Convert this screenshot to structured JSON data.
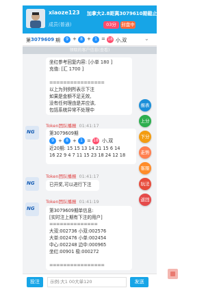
{
  "header": {
    "username": "xiaoze123",
    "user_tag": "成员(普通)",
    "issue_title": "加拿大2.8距离3079610期截止",
    "countdown": "03分",
    "status": "封盘中"
  },
  "result_bar": {
    "prefix": "第",
    "issue": "3079609",
    "qi": "期",
    "balls": [
      "9",
      "8",
      "1",
      "18"
    ],
    "ball_colors": [
      "#1e90ff",
      "#1e90ff",
      "#1e90ff",
      "#ff4d6d"
    ],
    "ops": [
      "+",
      "+",
      "="
    ],
    "tag": "小,双",
    "chevron": "chevron-down-icon"
  },
  "notice": "领取的客户信息(查看)",
  "bubble1": {
    "lines": [
      "坐红参考回复内容: [小单 180 ]",
      "充值: [汇 1700 ]",
      "",
      "================",
      "以上为列例所表示下注",
      "如果是金额不足无效,",
      "没有任何理由是并应该,",
      "包括系统异常不处理中"
    ]
  },
  "message2": {
    "sender": "Token团队播报",
    "time": "01:41:17",
    "avatar_text": "NG",
    "issue_line": "第3079609期",
    "balls": [
      "9",
      "8",
      "1",
      "18"
    ],
    "ball_colors": [
      "#1e90ff",
      "#1e90ff",
      "#1e90ff",
      "#ff4d6d"
    ],
    "ops": [
      "+",
      "+",
      "="
    ],
    "tag": "小,双",
    "history1": "近20期: 15 15 13 14 21 15 6 14",
    "history2": "16 22 9 4 7 11 15 23 18 24 12 18"
  },
  "message3": {
    "sender": "Token团队播报",
    "time": "01:41:17",
    "avatar_text": "NG",
    "text": "已开奖,可以进行下注"
  },
  "message4": {
    "sender": "Token团队播报",
    "time": "01:41:19",
    "avatar_text": "NG",
    "lines": [
      "第3079609期单信息:",
      "[实时注上期有下注的用户]",
      "==============",
      "大双:002736 小双:002576",
      "大单:002476 小单:002454",
      "中心:002248 边中:000965",
      "坐红:00901 极:000272",
      "",
      "================"
    ]
  },
  "fab_buttons": [
    {
      "label": "报表",
      "color": "#1b8fd9"
    },
    {
      "label": "上分",
      "color": "#2dae4f"
    },
    {
      "label": "下分",
      "color": "#f39c12"
    },
    {
      "label": "走势",
      "color": "#ff7f50"
    },
    {
      "label": "客服",
      "color": "#ff8c2a"
    },
    {
      "label": "玩法",
      "color": "#e74c3c"
    },
    {
      "label": "返回",
      "color": "#e54b4b"
    }
  ],
  "bottom": {
    "bet_label": "投注",
    "input_placeholder": "示例:大1 00大单120",
    "send_label": "发送"
  }
}
